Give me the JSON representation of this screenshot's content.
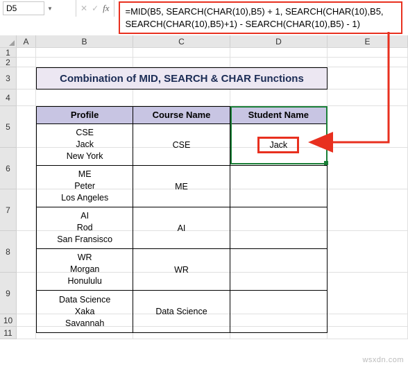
{
  "namebox": {
    "value": "D5"
  },
  "fx": {
    "cancel": "✕",
    "confirm": "✓",
    "label": "fx"
  },
  "formula": {
    "line1": "=MID(B5, SEARCH(CHAR(10),B5) + 1, SEARCH(CHAR(10),B5,",
    "line2": "SEARCH(CHAR(10),B5)+1) - SEARCH(CHAR(10),B5) - 1)"
  },
  "columns": {
    "A": "A",
    "B": "B",
    "C": "C",
    "D": "D",
    "E": "E"
  },
  "rows": {
    "r1": "1",
    "r2": "2",
    "r3": "3",
    "r4": "4",
    "r5": "5",
    "r6": "6",
    "r7": "7",
    "r8": "8",
    "r9": "9",
    "r10": "10",
    "r11": "11"
  },
  "title": "Combination of MID, SEARCH & CHAR Functions",
  "headers": {
    "profile": "Profile",
    "course": "Course Name",
    "student": "Student Name"
  },
  "data_rows": [
    {
      "p1": "CSE",
      "p2": "Jack",
      "p3": "New York",
      "course": "CSE",
      "student": "Jack"
    },
    {
      "p1": "ME",
      "p2": "Peter",
      "p3": "Los Angeles",
      "course": "ME",
      "student": ""
    },
    {
      "p1": "AI",
      "p2": "Rod",
      "p3": "San Fransisco",
      "course": "AI",
      "student": ""
    },
    {
      "p1": "WR",
      "p2": "Morgan",
      "p3": "Honululu",
      "course": "WR",
      "student": ""
    },
    {
      "p1": "Data Science",
      "p2": "Xaka",
      "p3": "Savannah",
      "course": "Data Science",
      "student": ""
    }
  ],
  "watermark": "wsxdn.com"
}
